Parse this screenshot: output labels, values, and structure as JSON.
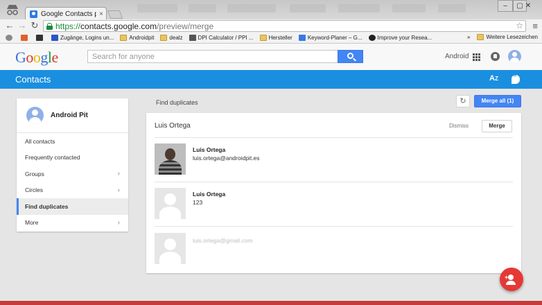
{
  "browser": {
    "tab_title": "Google Contacts preview",
    "tab_close": "×",
    "url_scheme": "https://",
    "url_host": "contacts.google.com",
    "url_path": "/preview/merge",
    "bookmarks": [
      {
        "label": "Zugänge, Logins un...",
        "icon": "bookmark-icon",
        "color": "#2b56c8"
      },
      {
        "label": "Androidpit",
        "icon": "folder-icon",
        "color": "#e9c463"
      },
      {
        "label": "dealz",
        "icon": "folder-icon",
        "color": "#e9c463"
      },
      {
        "label": "DPI Calculator / PPI ...",
        "icon": "calculator-icon",
        "color": "#555555"
      },
      {
        "label": "Hersteller",
        "icon": "folder-icon",
        "color": "#e9c463"
      },
      {
        "label": "Keyword-Planer – G...",
        "icon": "adwords-icon",
        "color": "#3b78e7"
      },
      {
        "label": "Improve your Resea...",
        "icon": "search-console-icon",
        "color": "#222222"
      }
    ],
    "more_bookmarks": "»",
    "other_bookmarks": "Weitere Lesezeichen"
  },
  "header": {
    "logo_letters": [
      "G",
      "o",
      "o",
      "g",
      "l",
      "e"
    ],
    "search_placeholder": "Search for anyone",
    "account_label": "Android"
  },
  "appbar": {
    "title": "Contacts",
    "sort_label": "A",
    "sort_sub": "Z",
    "accent": "#1a8fe0"
  },
  "sidebar": {
    "profile_name": "Android Pit",
    "items": [
      {
        "label": "All contacts",
        "chevron": false,
        "active": false
      },
      {
        "label": "Frequently contacted",
        "chevron": false,
        "active": false
      },
      {
        "label": "Groups",
        "chevron": true,
        "active": false
      },
      {
        "label": "Circles",
        "chevron": true,
        "active": false
      },
      {
        "label": "Find duplicates",
        "chevron": false,
        "active": true
      },
      {
        "label": "More",
        "chevron": true,
        "active": false
      }
    ]
  },
  "main": {
    "title": "Find duplicates",
    "refresh_icon": "↻",
    "merge_all_label": "Merge all (1)",
    "group": {
      "name": "Luis Ortega",
      "dismiss_label": "Dismiss",
      "merge_label": "Merge",
      "entries": [
        {
          "name": "Luis Ortega",
          "detail": "luis.ortega@androidpit.es",
          "photo": true
        },
        {
          "name": "Luis Ortega",
          "detail": "123",
          "photo": false
        },
        {
          "name": "",
          "detail": "luis.ortega@gmail.com",
          "photo": false
        }
      ]
    }
  },
  "colors": {
    "primary_blue": "#4285f4",
    "fab_red": "#e53935"
  }
}
